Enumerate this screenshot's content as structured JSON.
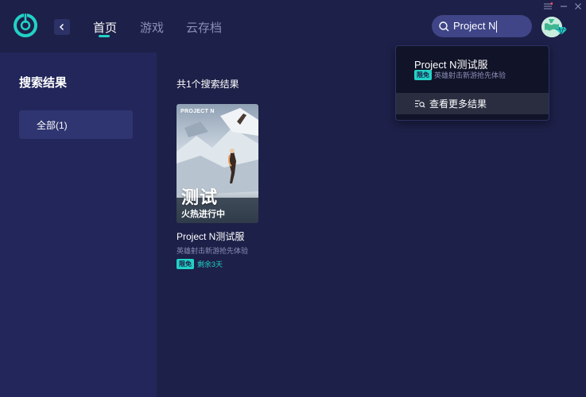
{
  "nav": {
    "tabs": [
      {
        "label": "首页",
        "active": true
      },
      {
        "label": "游戏",
        "active": false
      },
      {
        "label": "云存档",
        "active": false
      }
    ]
  },
  "search": {
    "value": "Project N"
  },
  "sidebar": {
    "title": "搜索结果",
    "filters": [
      {
        "label": "全部(1)",
        "selected": true
      }
    ]
  },
  "main": {
    "result_count": "共1个搜索结果",
    "games": [
      {
        "name": "Project N测试服",
        "description": "英雄射击新游抢先体验",
        "badge": "限免",
        "remaining": "剩余3天",
        "cover": {
          "brand": "PROJECT N",
          "title": "测试",
          "subtitle": "火热进行中"
        }
      }
    ]
  },
  "dropdown": {
    "suggestion": {
      "title": "Project N测试服",
      "badge": "限免",
      "description": "英雄射击新游抢先体验"
    },
    "more_label": "查看更多结果"
  },
  "colors": {
    "background": "#1d2048",
    "sidebar": "#22265a",
    "accent": "#22d1c6",
    "search_bg": "#3f4587",
    "dropdown_bg": "#111328"
  }
}
